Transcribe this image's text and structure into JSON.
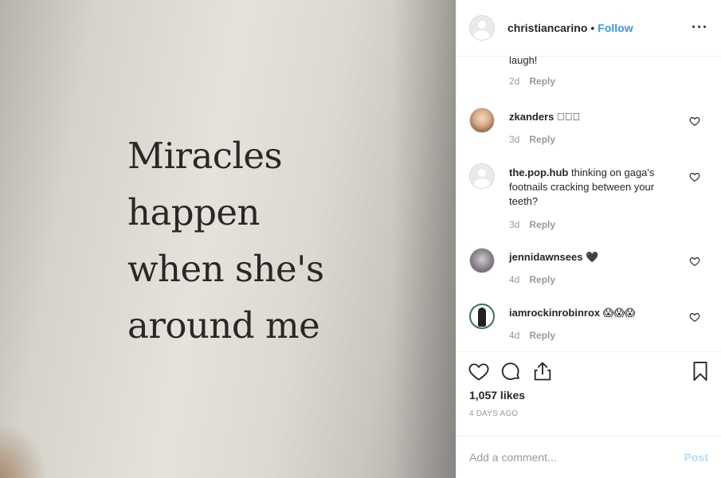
{
  "photo": {
    "quote_lines": [
      "Miracles",
      "happen",
      "when she's",
      "around me"
    ]
  },
  "header": {
    "username": "christiancarino",
    "separator": "•",
    "follow_label": "Follow",
    "more_label": "···"
  },
  "comments": [
    {
      "text": "laugh!",
      "age": "2d",
      "reply": "Reply"
    },
    {
      "user": "zkanders",
      "text": "󾌵󾌵󾌵",
      "age": "3d",
      "reply": "Reply"
    },
    {
      "user": "the.pop.hub",
      "text": "thinking on gaga's footnails cracking between your teeth?",
      "age": "3d",
      "reply": "Reply"
    },
    {
      "user": "jennidawnsees",
      "text": "🖤",
      "age": "4d",
      "reply": "Reply"
    },
    {
      "user": "iamrockinrobinrox",
      "text": "😱😱😱",
      "age": "4d",
      "reply": "Reply"
    }
  ],
  "footer": {
    "likes": "1,057 likes",
    "time_ago": "4 DAYS AGO",
    "comment_placeholder": "Add a comment...",
    "post_label": "Post"
  },
  "colors": {
    "accent": "#3897f0",
    "post_disabled": "#b2dffc",
    "muted": "#999999"
  }
}
